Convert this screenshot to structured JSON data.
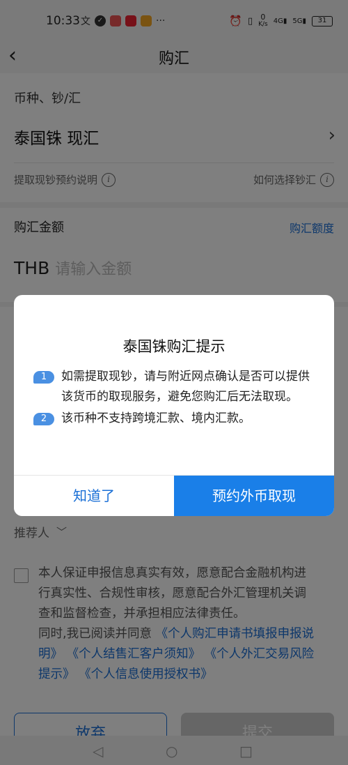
{
  "status_bar": {
    "time": "10:33",
    "network_speed_value": "0",
    "network_speed_unit": "K/s",
    "signal1_label": "4G",
    "signal2_label": "5G",
    "battery": "31"
  },
  "header": {
    "title": "购汇"
  },
  "currency_section": {
    "label": "币种、钞/汇",
    "value": "泰国铢 现汇",
    "hint_left": "提取现钞预约说明",
    "hint_right": "如何选择钞汇"
  },
  "amount_section": {
    "label": "购汇金额",
    "quota_link": "购汇额度",
    "currency_code": "THB",
    "placeholder": "请输入金额"
  },
  "referrer": {
    "label": "推荐人"
  },
  "agreement": {
    "line1": "本人保证申报信息真实有效，愿意配合金融机构进",
    "line2": "行真实性、合规性审核，愿意配合外汇管理机关调",
    "line3": "查和监督检查，并承担相应法律责任。",
    "line4_prefix": "同时,我已阅读并同意 ",
    "link1_part1": "《个人购汇申请书填报申报说",
    "link1_part2": "明》",
    "link2": "《个人结售汇客户须知》",
    "link3_part1": "《个人外汇交易风险",
    "link3_part2": "提示》",
    "link4": "《个人信息使用授权书》"
  },
  "buttons": {
    "give_up": "放弃",
    "submit": "提交"
  },
  "dialog": {
    "title": "泰国铢购汇提示",
    "items": [
      {
        "num": "1",
        "line1": "如需提取现钞，请与附近网点确认是否可以提供",
        "line2": "该货币的取现服务，避免您购汇后无法取现。"
      },
      {
        "num": "2",
        "line1": "该币种不支持跨境汇款、境内汇款。"
      }
    ],
    "ok_label": "知道了",
    "reserve_label": "预约外币取现"
  },
  "colors": {
    "accent": "#1a7fe8",
    "link": "#1a6fd6",
    "badge": "#4a90e2"
  }
}
